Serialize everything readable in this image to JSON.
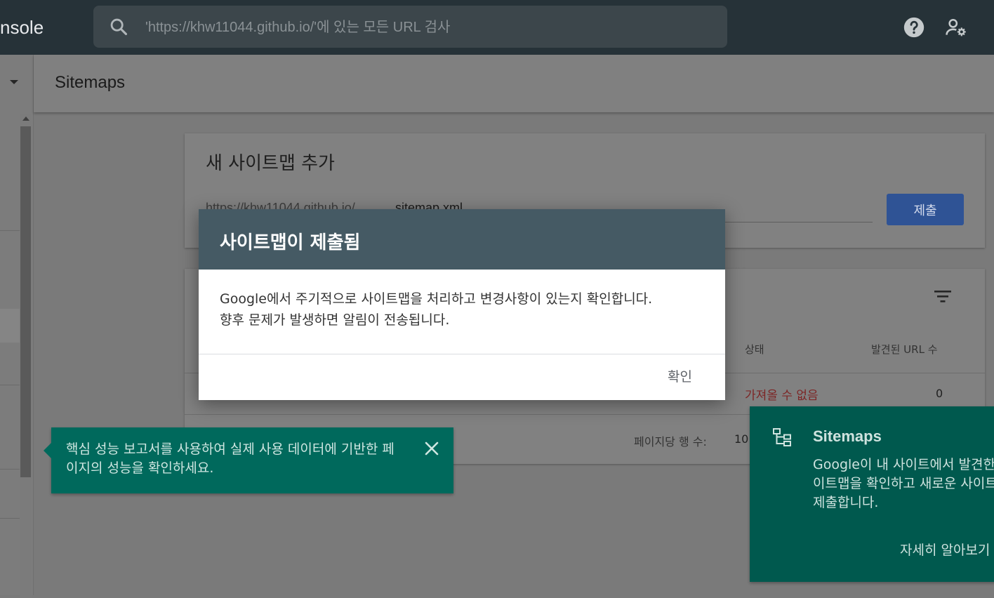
{
  "topbar": {
    "app_name": "nsole",
    "search_placeholder": "'https://khw11044.github.io/'에 있는 모든 URL 검사",
    "icons": [
      "search-icon",
      "help-icon",
      "manage-users-icon"
    ]
  },
  "header": {
    "title": "Sitemaps"
  },
  "add_sitemap": {
    "title": "새 사이트맵 추가",
    "url_prefix": "https://khw11044.github.io/",
    "input_value": "sitemap.xml",
    "submit_label": "제출"
  },
  "submitted_list": {
    "columns": {
      "status": "상태",
      "found_urls": "발견된 URL 수"
    },
    "rows": [
      {
        "status": "가져올 수 없음",
        "found_urls": "0"
      }
    ],
    "rows_per_page_label": "페이지당 행 수:",
    "rows_per_page_value": "10"
  },
  "tooltip": {
    "text": "핵심 성능 보고서를 사용하여 실제 사용 데이터에 기반한 페이지의 성능을 확인하세요."
  },
  "info_panel": {
    "title": "Sitemaps",
    "text": "Google이 내 사이트에서 발견한 사이트맵을 확인하고 새로운 사이트맵을 제출합니다.",
    "link": "자세히 알아보기"
  },
  "dialog": {
    "title": "사이트맵이 제출됨",
    "body_line1": "Google에서 주기적으로 사이트맵을 처리하고 변경사항이 있는지 확인합니다.",
    "body_line2": "향후 문제가 발생하면 알림이 전송됩니다.",
    "ok_label": "확인"
  },
  "colors": {
    "topbar": "#263238",
    "dialog_header": "#455a64",
    "tooltip": "#00695c",
    "info_panel": "#00594e",
    "primary_button": "#2f5395",
    "error_text": "#7d2626"
  }
}
